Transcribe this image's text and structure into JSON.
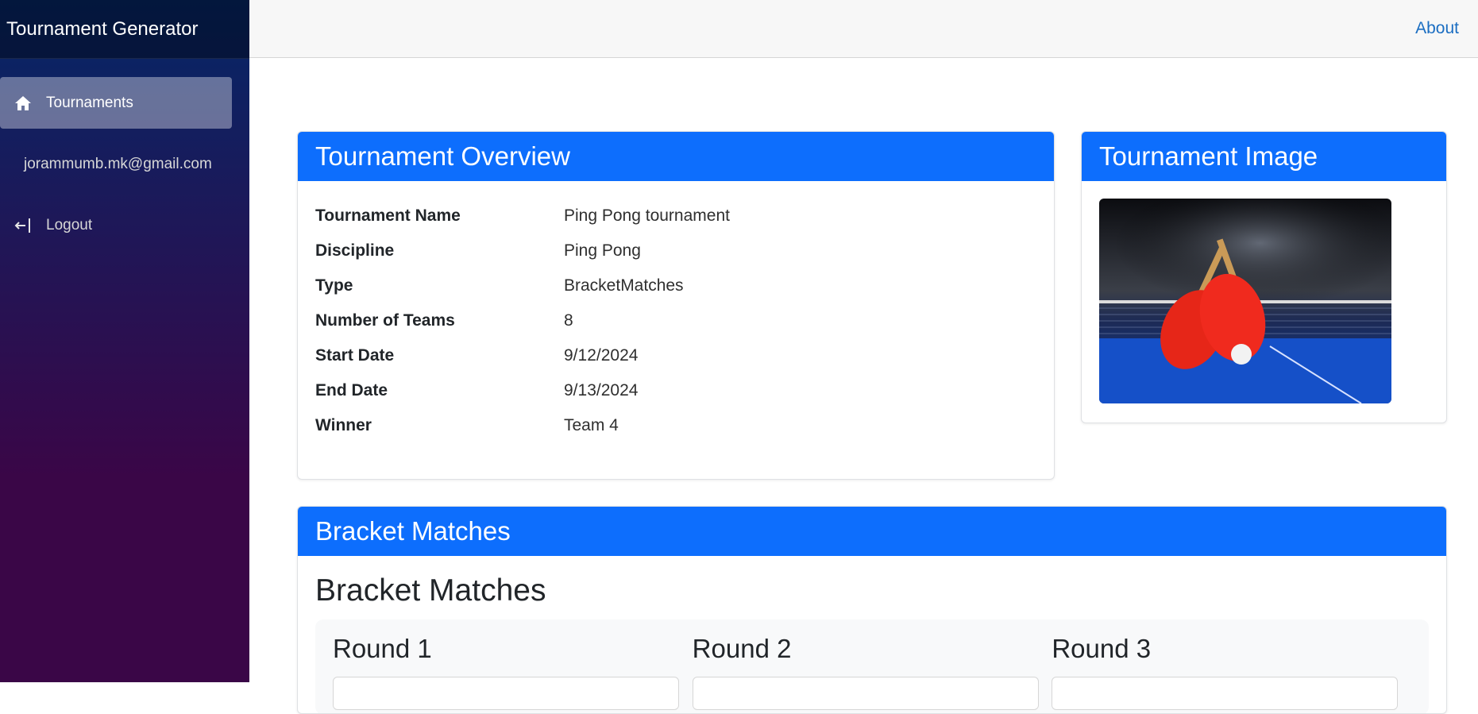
{
  "app": {
    "title": "Tournament Generator"
  },
  "topbar": {
    "about_label": "About"
  },
  "sidebar": {
    "items": [
      {
        "label": "Tournaments",
        "icon": "home-icon",
        "active": true
      },
      {
        "label": "jorammumb.mk@gmail.com",
        "icon": "",
        "active": false
      },
      {
        "label": "Logout",
        "icon": "logout-icon",
        "active": false
      }
    ]
  },
  "overview": {
    "title": "Tournament Overview",
    "rows": [
      {
        "label": "Tournament Name",
        "value": "Ping Pong tournament"
      },
      {
        "label": "Discipline",
        "value": "Ping Pong"
      },
      {
        "label": "Type",
        "value": "BracketMatches"
      },
      {
        "label": "Number of Teams",
        "value": "8"
      },
      {
        "label": "Start Date",
        "value": "9/12/2024"
      },
      {
        "label": "End Date",
        "value": "9/13/2024"
      },
      {
        "label": "Winner",
        "value": "Team 4"
      }
    ]
  },
  "image_card": {
    "title": "Tournament Image"
  },
  "bracket": {
    "header": "Bracket Matches",
    "heading": "Bracket Matches",
    "rounds": [
      {
        "title": "Round 1"
      },
      {
        "title": "Round 2"
      },
      {
        "title": "Round 3"
      }
    ]
  },
  "colors": {
    "primary": "#0d6efd",
    "sidebar_top": "#052767",
    "sidebar_bottom": "#3a0647",
    "link": "#1b6ec2"
  }
}
